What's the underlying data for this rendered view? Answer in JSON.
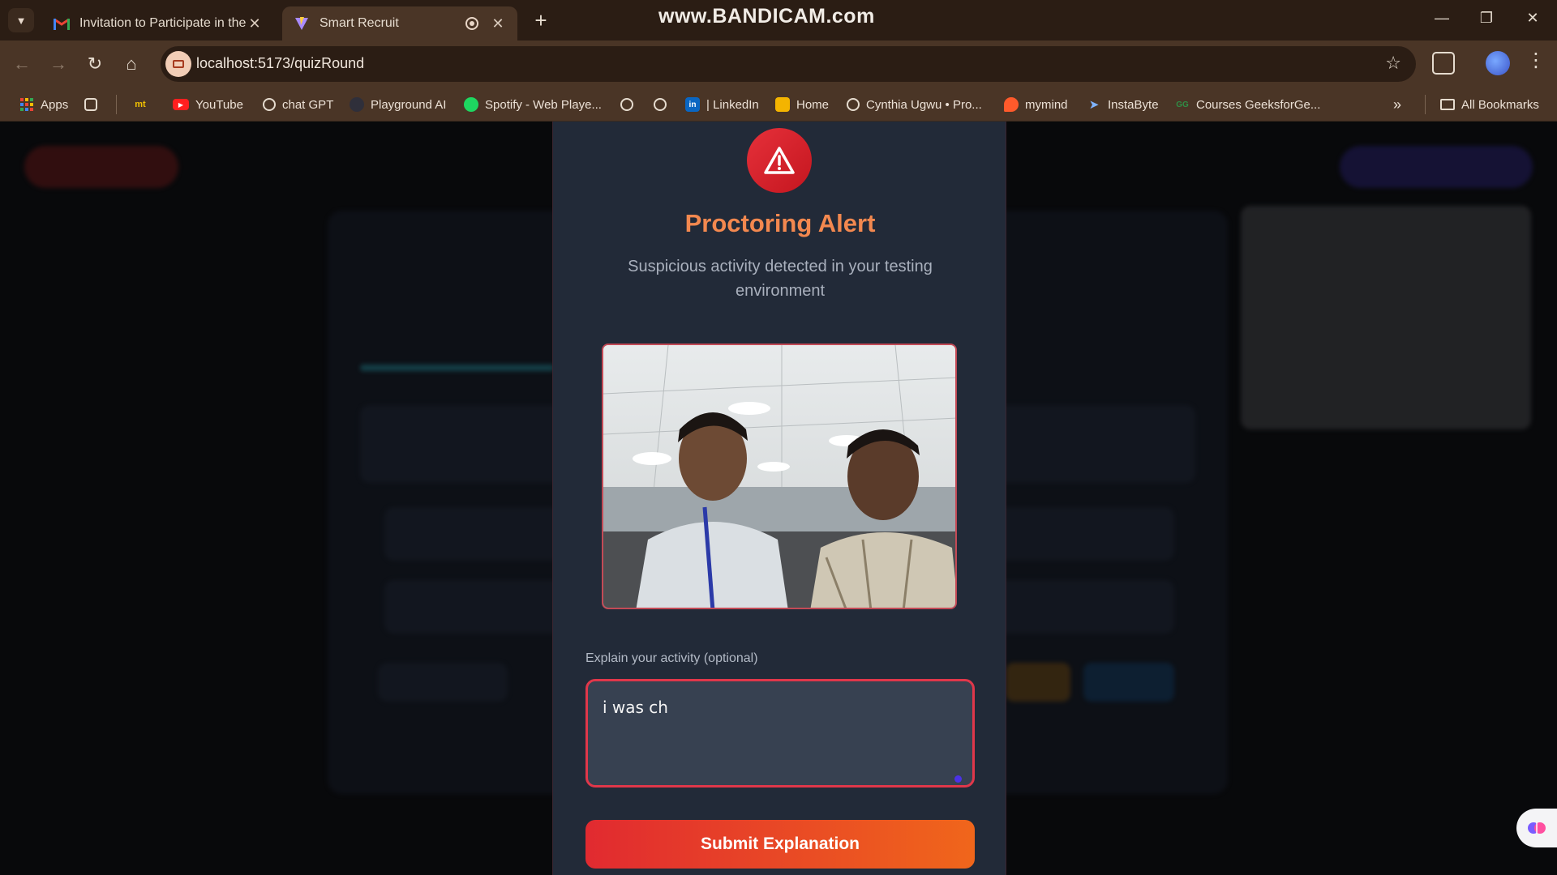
{
  "browser": {
    "tabs": [
      {
        "title": "Invitation to Participate in the R",
        "favicon": "gmail-icon",
        "active": false
      },
      {
        "title": "Smart Recruit",
        "favicon": "vite-icon",
        "active": true
      }
    ],
    "watermark": "www.BANDICAM.com",
    "url": "localhost:5173/quizRound",
    "bookmarks": [
      {
        "label": "Apps",
        "icon": "apps-grid-icon"
      },
      {
        "label": "",
        "icon": "tab-groups-icon"
      },
      {
        "label": "",
        "icon": "mt-icon"
      },
      {
        "label": "YouTube",
        "icon": "youtube-icon"
      },
      {
        "label": "chat GPT",
        "icon": "openai-icon"
      },
      {
        "label": "Playground AI",
        "icon": "playground-icon"
      },
      {
        "label": "Spotify - Web Playe...",
        "icon": "spotify-icon"
      },
      {
        "label": "",
        "icon": "globe-icon"
      },
      {
        "label": "",
        "icon": "globe-icon"
      },
      {
        "label": "| LinkedIn",
        "icon": "linkedin-icon"
      },
      {
        "label": "Home",
        "icon": "classroom-icon"
      },
      {
        "label": "Cynthia Ugwu • Pro...",
        "icon": "person-icon"
      },
      {
        "label": "mymind",
        "icon": "mymind-icon"
      },
      {
        "label": "InstaByte",
        "icon": "rocket-icon"
      },
      {
        "label": "Courses GeeksforGe...",
        "icon": "gfg-icon"
      }
    ],
    "all_bookmarks": "All Bookmarks"
  },
  "modal": {
    "title": "Proctoring Alert",
    "subtitle": "Suspicious activity detected in your testing environment",
    "snapshot_icon": "webcam-snapshot",
    "field_label": "Explain your activity (optional)",
    "explanation_value": "i was ch",
    "submit_label": "Submit Explanation"
  },
  "colors": {
    "accent_title": "#f3884f",
    "alert_red": "#e0374a",
    "submit_gradient_start": "#e12a30",
    "submit_gradient_end": "#f0661b",
    "modal_bg": "#222a38"
  }
}
